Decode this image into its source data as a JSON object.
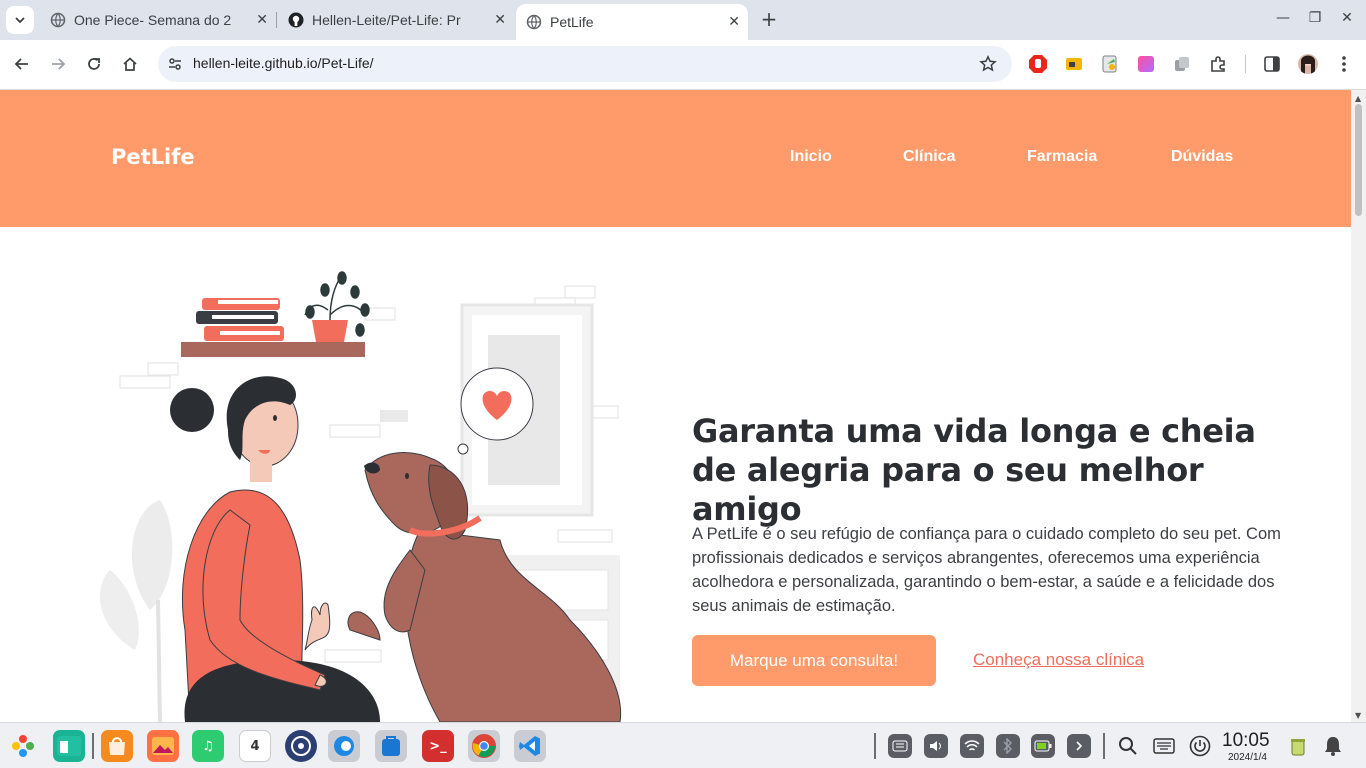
{
  "browser": {
    "tabs": [
      {
        "title": "One Piece- Semana do 2",
        "active": false
      },
      {
        "title": "Hellen-Leite/Pet-Life: Pr",
        "active": false
      },
      {
        "title": "PetLife",
        "active": true
      }
    ],
    "url": "hellen-leite.github.io/Pet-Life/"
  },
  "site": {
    "logo": "PetLife",
    "nav": [
      "Inicio",
      "Clínica",
      "Farmacia",
      "Dúvidas"
    ],
    "hero": {
      "title": "Garanta uma vida longa e cheia de alegria para o seu melhor amigo",
      "text": "A PetLife é o seu refúgio de confiança para o cuidado completo do seu pet. Com profissionais dedicados e serviços abrangentes, oferecemos uma experiência acolhedora e personalizada, garantindo o bem-estar, a saúde e a felicidade dos seus animais de estimação.",
      "cta_button": "Marque uma consulta!",
      "cta_link": "Conheça nossa clínica"
    },
    "colors": {
      "header": "#ff9b6a",
      "accent_link": "#f26d5b",
      "title": "#2b2e33"
    }
  },
  "taskbar": {
    "calendar_day": "4",
    "time": "10:05",
    "date": "2024/1/4"
  }
}
